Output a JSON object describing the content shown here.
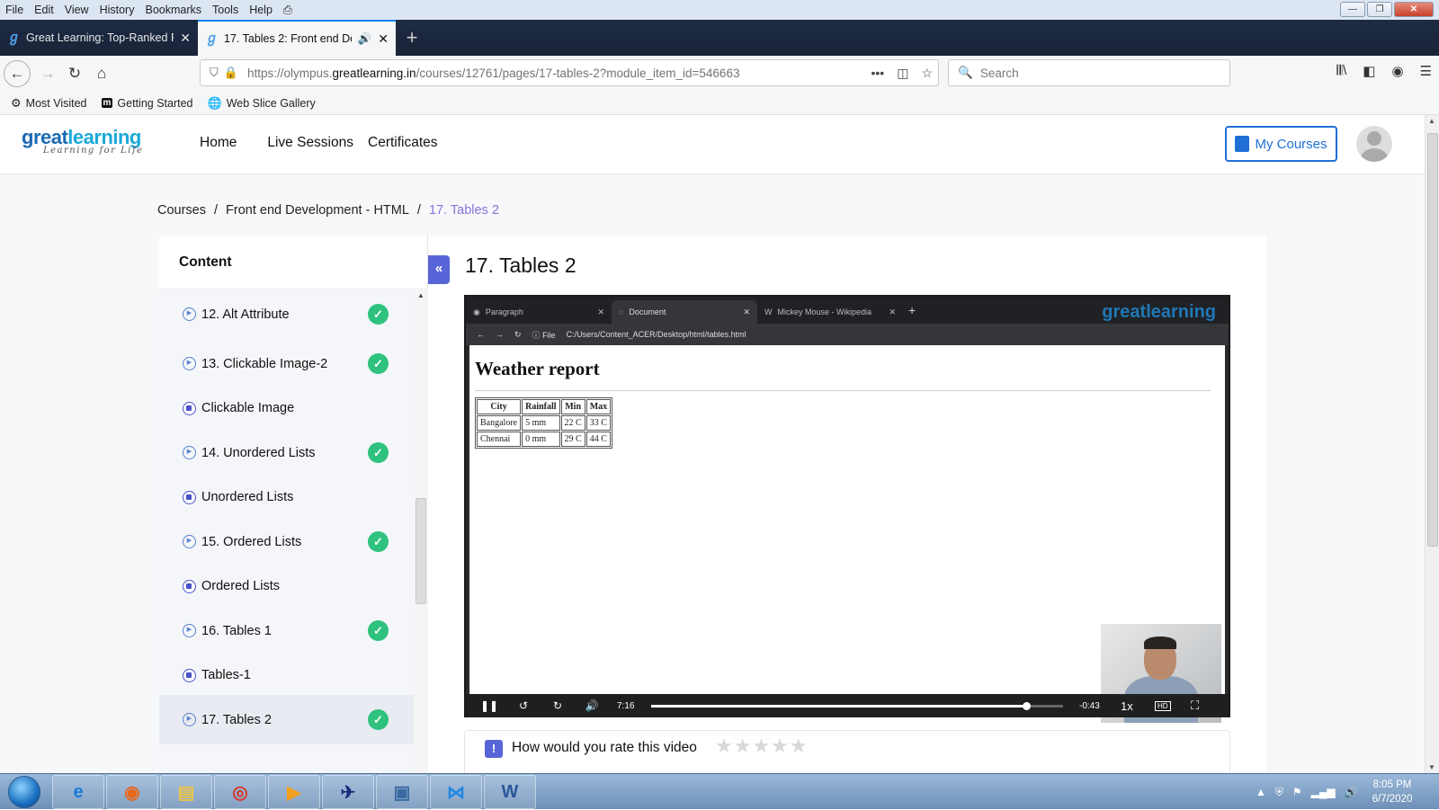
{
  "menubar": {
    "items": [
      "File",
      "Edit",
      "View",
      "History",
      "Bookmarks",
      "Tools",
      "Help"
    ]
  },
  "tabs": [
    {
      "title": "Great Learning: Top-Ranked Pr"
    },
    {
      "title": "17. Tables 2: Front end Deve"
    }
  ],
  "address": {
    "url_prefix": "https://olympus.",
    "url_domain": "greatlearning.in",
    "url_path": "/courses/12761/pages/17-tables-2?module_item_id=546663"
  },
  "search": {
    "placeholder": "Search"
  },
  "bookmarks": [
    {
      "label": "Most Visited"
    },
    {
      "label": "Getting Started"
    },
    {
      "label": "Web Slice Gallery"
    }
  ],
  "site": {
    "logo_main": "great",
    "logo_accent": "learning",
    "logo_tagline": "Learning for Life",
    "nav": [
      "Home",
      "Live Sessions",
      "Certificates"
    ],
    "my_courses": "My Courses"
  },
  "breadcrumb": {
    "items": [
      "Courses",
      "/",
      "Front end Development - HTML",
      "/",
      "17. Tables 2"
    ]
  },
  "sidebar": {
    "title": "Content",
    "items": [
      {
        "label": "12. Alt Attribute",
        "kind": "video",
        "done": true
      },
      {
        "label": "13. Clickable Image-2",
        "kind": "video",
        "done": true
      },
      {
        "label": "Clickable Image",
        "kind": "doc",
        "done": false
      },
      {
        "label": "14. Unordered Lists",
        "kind": "video",
        "done": true
      },
      {
        "label": "Unordered Lists",
        "kind": "doc",
        "done": false
      },
      {
        "label": "15. Ordered Lists",
        "kind": "video",
        "done": true
      },
      {
        "label": "Ordered Lists",
        "kind": "doc",
        "done": false
      },
      {
        "label": "16. Tables 1",
        "kind": "video",
        "done": true
      },
      {
        "label": "Tables-1",
        "kind": "doc",
        "done": false
      },
      {
        "label": "17. Tables 2",
        "kind": "video",
        "done": true,
        "active": true
      }
    ]
  },
  "content": {
    "title": "17. Tables 2",
    "video": {
      "tabs": [
        "Paragraph",
        "Document",
        "Mickey Mouse - Wikipedia"
      ],
      "logo": "greatlearning",
      "address": "C:/Users/Content_ACER/Desktop/html/tables.html",
      "file_label": "File",
      "page_heading": "Weather report",
      "table": {
        "headers": [
          "City",
          "Rainfall",
          "Min",
          "Max"
        ],
        "rows": [
          [
            "Bangalore",
            "5 mm",
            "22 C",
            "33 C"
          ],
          [
            "Chennai",
            "0 mm",
            "29 C",
            "44 C"
          ]
        ]
      },
      "current_time": "7:16",
      "remaining": "-0:43",
      "progress": 0.91,
      "speed": "1x",
      "hd": "HD"
    },
    "rate_prompt": "How would you rate this video",
    "stars": "★★★★★"
  },
  "taskbar": {
    "time": "8:05 PM",
    "date": "6/7/2020"
  }
}
